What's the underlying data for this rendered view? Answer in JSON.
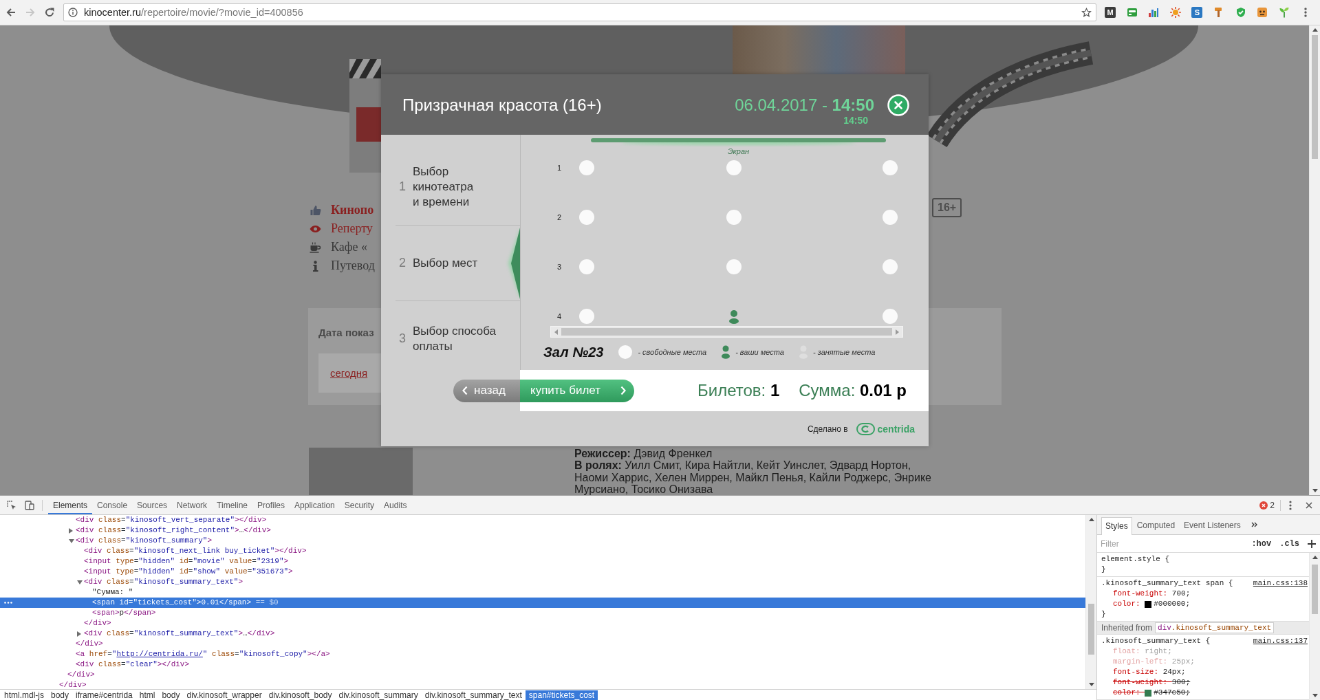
{
  "browser": {
    "nav": [
      {
        "kind": "back",
        "disabled": false
      },
      {
        "kind": "forward",
        "disabled": true
      },
      {
        "kind": "reload",
        "disabled": false
      }
    ],
    "url": {
      "host": "kinocenter.ru",
      "path": "/repertoire/movie/?movie_id=400856"
    },
    "extensions": [
      {
        "kind": "letter",
        "label": "M",
        "color": "#3c3c3c"
      },
      {
        "kind": "window"
      },
      {
        "kind": "bars"
      },
      {
        "kind": "sun"
      },
      {
        "kind": "letter",
        "label": "S",
        "color": "#2b78c2"
      },
      {
        "kind": "hammer"
      },
      {
        "kind": "shield"
      },
      {
        "kind": "mascot"
      },
      {
        "kind": "sprout"
      }
    ]
  },
  "site": {
    "menu": [
      {
        "kind": "like",
        "text": "Кинопо"
      },
      {
        "kind": "eye",
        "text": "Реперту"
      },
      {
        "kind": "cup",
        "text": "Кафе «"
      },
      {
        "kind": "info",
        "text": "Путевод"
      }
    ],
    "age_badge": "16+",
    "date_panel": {
      "label": "Дата показ",
      "options": [
        {
          "text": "сегодня"
        }
      ]
    },
    "director": "**Режиссер:** Дэвид Френкел",
    "cast": "**В ролях:** Уилл Смит, Кира Найтли, Кейт Уинслет, Эдвард Нортон, Наоми Харрис, Хелен Миррен, Майкл Пенья, Кайли Роджерс, Энрике Мурсиано, Тосико Онизава"
  },
  "modal": {
    "title": "Призрачная красота (16+)",
    "date": "06.04.2017 - **14:50**",
    "time": "14:50",
    "steps": [
      {
        "number": "1",
        "label": "Выбор кинотеатра\nи времени",
        "selected": false
      },
      {
        "number": "2",
        "label": "Выбор мест",
        "selected": true
      },
      {
        "number": "3",
        "label": "Выбор способа оплаты",
        "selected": false
      }
    ],
    "screen": "Экран",
    "rows": [
      {
        "label": "1",
        "seats": [
          {
            "selected": false
          },
          {
            "selected": false
          },
          {
            "selected": false
          }
        ]
      },
      {
        "label": "2",
        "seats": [
          {
            "selected": false
          },
          {
            "selected": false
          },
          {
            "selected": false
          }
        ]
      },
      {
        "label": "3",
        "seats": [
          {
            "selected": false
          },
          {
            "selected": false
          },
          {
            "selected": false
          }
        ]
      },
      {
        "label": "4",
        "seats": [
          {
            "selected": false
          },
          {
            "selected": true
          },
          {
            "selected": false
          }
        ]
      }
    ],
    "hall": "Зал №23",
    "legend": [
      {
        "kind": "free",
        "text": "- свободные места"
      },
      {
        "kind": "mine",
        "text": "- ваши места"
      },
      {
        "kind": "taken",
        "text": "- занятые места"
      }
    ],
    "back_button": "назад",
    "buy_button": "купить билет",
    "summary": [
      "Билетов: **1**",
      "Сумма: **0.01 р**"
    ],
    "footer": {
      "credit": "Сделано в",
      "brand": "centrida"
    }
  },
  "devtools": {
    "tabs": [
      {
        "label": "Elements",
        "selected": true
      },
      {
        "label": "Console",
        "selected": false
      },
      {
        "label": "Sources",
        "selected": false
      },
      {
        "label": "Network",
        "selected": false
      },
      {
        "label": "Timeline",
        "selected": false
      },
      {
        "label": "Profiles",
        "selected": false
      },
      {
        "label": "Application",
        "selected": false
      },
      {
        "label": "Security",
        "selected": false
      },
      {
        "label": "Audits",
        "selected": false
      }
    ],
    "error_count": "2",
    "dom_tree": [
      {
        "selected": false,
        "close": "</div>",
        "children": [
          {
            "selected": false,
            "close": "</div>",
            "children": [
              {
                "selected": false,
                "parts": [
                  {
                    "kind": "tag",
                    "text": "<div "
                  },
                  {
                    "kind": "attr",
                    "text": "class"
                  },
                  {
                    "kind": "punct",
                    "text": "="
                  },
                  {
                    "kind": "value",
                    "text": "\"kinosoft_vert_separate\""
                  },
                  {
                    "kind": "tag",
                    "text": "></div>"
                  }
                ]
              },
              {
                "selected": false,
                "expanded": false,
                "parts": [
                  {
                    "kind": "tag",
                    "text": "<div "
                  },
                  {
                    "kind": "attr",
                    "text": "class"
                  },
                  {
                    "kind": "punct",
                    "text": "="
                  },
                  {
                    "kind": "value",
                    "text": "\"kinosoft_right_content\""
                  },
                  {
                    "kind": "tag",
                    "text": ">"
                  },
                  {
                    "kind": "text",
                    "text": "…"
                  },
                  {
                    "kind": "tag",
                    "text": "</div>"
                  }
                ]
              },
              {
                "selected": false,
                "expanded": true,
                "parts": [
                  {
                    "kind": "tag",
                    "text": "<div "
                  },
                  {
                    "kind": "attr",
                    "text": "class"
                  },
                  {
                    "kind": "punct",
                    "text": "="
                  },
                  {
                    "kind": "value",
                    "text": "\"kinosoft_summary\""
                  },
                  {
                    "kind": "tag",
                    "text": ">"
                  }
                ],
                "close": "</div>",
                "children": [
                  {
                    "selected": false,
                    "parts": [
                      {
                        "kind": "tag",
                        "text": "<div "
                      },
                      {
                        "kind": "attr",
                        "text": "class"
                      },
                      {
                        "kind": "punct",
                        "text": "="
                      },
                      {
                        "kind": "value",
                        "text": "\"kinosoft_next_link buy_ticket\""
                      },
                      {
                        "kind": "tag",
                        "text": "></div>"
                      }
                    ]
                  },
                  {
                    "selected": false,
                    "parts": [
                      {
                        "kind": "tag",
                        "text": "<input "
                      },
                      {
                        "kind": "attr",
                        "text": "type"
                      },
                      {
                        "kind": "punct",
                        "text": "="
                      },
                      {
                        "kind": "value",
                        "text": "\"hidden\""
                      },
                      {
                        "kind": "attr",
                        "text": " id"
                      },
                      {
                        "kind": "punct",
                        "text": "="
                      },
                      {
                        "kind": "value",
                        "text": "\"movie\""
                      },
                      {
                        "kind": "attr",
                        "text": " value"
                      },
                      {
                        "kind": "punct",
                        "text": "="
                      },
                      {
                        "kind": "value",
                        "text": "\"2319\""
                      },
                      {
                        "kind": "tag",
                        "text": ">"
                      }
                    ]
                  },
                  {
                    "selected": false,
                    "parts": [
                      {
                        "kind": "tag",
                        "text": "<input "
                      },
                      {
                        "kind": "attr",
                        "text": "type"
                      },
                      {
                        "kind": "punct",
                        "text": "="
                      },
                      {
                        "kind": "value",
                        "text": "\"hidden\""
                      },
                      {
                        "kind": "attr",
                        "text": " id"
                      },
                      {
                        "kind": "punct",
                        "text": "="
                      },
                      {
                        "kind": "value",
                        "text": "\"show\""
                      },
                      {
                        "kind": "attr",
                        "text": " value"
                      },
                      {
                        "kind": "punct",
                        "text": "="
                      },
                      {
                        "kind": "value",
                        "text": "\"351673\""
                      },
                      {
                        "kind": "tag",
                        "text": ">"
                      }
                    ]
                  },
                  {
                    "selected": false,
                    "expanded": true,
                    "parts": [
                      {
                        "kind": "tag",
                        "text": "<div "
                      },
                      {
                        "kind": "attr",
                        "text": "class"
                      },
                      {
                        "kind": "punct",
                        "text": "="
                      },
                      {
                        "kind": "value",
                        "text": "\"kinosoft_summary_text\""
                      },
                      {
                        "kind": "tag",
                        "text": ">"
                      }
                    ],
                    "close": "</div>",
                    "children": [
                      {
                        "selected": false,
                        "parts": [
                          {
                            "kind": "text",
                            "text": "\"Сумма: \""
                          }
                        ]
                      },
                      {
                        "selected": true,
                        "parts": [
                          {
                            "kind": "tag",
                            "text": "<span "
                          },
                          {
                            "kind": "attr",
                            "text": "id"
                          },
                          {
                            "kind": "punct",
                            "text": "="
                          },
                          {
                            "kind": "value",
                            "text": "\"tickets_cost\""
                          },
                          {
                            "kind": "tag",
                            "text": ">"
                          },
                          {
                            "kind": "text",
                            "text": "0.01"
                          },
                          {
                            "kind": "tag",
                            "text": "</span>"
                          },
                          {
                            "kind": "note",
                            "text": " == $0"
                          }
                        ]
                      },
                      {
                        "selected": false,
                        "parts": [
                          {
                            "kind": "tag",
                            "text": "<span>"
                          },
                          {
                            "kind": "text",
                            "text": "р"
                          },
                          {
                            "kind": "tag",
                            "text": "</span>"
                          }
                        ]
                      }
                    ]
                  },
                  {
                    "selected": false,
                    "expanded": false,
                    "parts": [
                      {
                        "kind": "tag",
                        "text": "<div "
                      },
                      {
                        "kind": "attr",
                        "text": "class"
                      },
                      {
                        "kind": "punct",
                        "text": "="
                      },
                      {
                        "kind": "value",
                        "text": "\"kinosoft_summary_text\""
                      },
                      {
                        "kind": "tag",
                        "text": ">"
                      },
                      {
                        "kind": "text",
                        "text": "…"
                      },
                      {
                        "kind": "tag",
                        "text": "</div>"
                      }
                    ]
                  }
                ]
              },
              {
                "selected": false,
                "parts": [
                  {
                    "kind": "tag",
                    "text": "<a "
                  },
                  {
                    "kind": "attr",
                    "text": "href"
                  },
                  {
                    "kind": "punct",
                    "text": "="
                  },
                  {
                    "kind": "value",
                    "text": "\""
                  },
                  {
                    "kind": "link",
                    "text": "http://centrida.ru/"
                  },
                  {
                    "kind": "value",
                    "text": "\""
                  },
                  {
                    "kind": "attr",
                    "text": " class"
                  },
                  {
                    "kind": "punct",
                    "text": "="
                  },
                  {
                    "kind": "value",
                    "text": "\"kinosoft_copy\""
                  },
                  {
                    "kind": "tag",
                    "text": "></a>"
                  }
                ]
              },
              {
                "selected": false,
                "parts": [
                  {
                    "kind": "tag",
                    "text": "<div "
                  },
                  {
                    "kind": "attr",
                    "text": "class"
                  },
                  {
                    "kind": "punct",
                    "text": "="
                  },
                  {
                    "kind": "value",
                    "text": "\"clear\""
                  },
                  {
                    "kind": "tag",
                    "text": "></div>"
                  }
                ]
              }
            ]
          }
        ]
      }
    ],
    "breadcrumbs": [
      {
        "label": "html.mdl-js",
        "selected": false
      },
      {
        "label": "body",
        "selected": false
      },
      {
        "label": "iframe#centrida",
        "selected": false
      },
      {
        "label": "html",
        "selected": false
      },
      {
        "label": "body",
        "selected": false
      },
      {
        "label": "div.kinosoft_wrapper",
        "selected": false
      },
      {
        "label": "div.kinosoft_body",
        "selected": false
      },
      {
        "label": "div.kinosoft_summary",
        "selected": false
      },
      {
        "label": "div.kinosoft_summary_text",
        "selected": false
      },
      {
        "label": "span#tickets_cost",
        "selected": true
      }
    ],
    "style_tabs": [
      {
        "label": "Styles",
        "selected": true
      },
      {
        "label": "Computed",
        "selected": false
      },
      {
        "label": "Event Listeners",
        "selected": false
      }
    ],
    "filter": {
      "placeholder": "Filter"
    },
    "filter_buttons": [
      ":hov",
      ".cls"
    ],
    "style_sections": [
      {
        "kind": "rule",
        "selector": "element.style {",
        "close": "}"
      },
      {
        "kind": "rule",
        "selector": ".kinosoft_summary_text span {",
        "source": "main.css:138",
        "properties": [
          {
            "name": "font-weight: ",
            "value": "700;",
            "inactive": false,
            "overridden": false
          },
          {
            "name": "color: ",
            "value": "#000000;",
            "color": "#000000",
            "inactive": false,
            "overridden": false
          }
        ],
        "close": "}"
      },
      {
        "kind": "inherited",
        "label": "Inherited from",
        "tag": "div",
        "selector": ".kinosoft_summary_text"
      },
      {
        "kind": "rule",
        "selector": ".kinosoft_summary_text {",
        "source": "main.css:137",
        "properties": [
          {
            "name": "float: ",
            "value": "right;",
            "inactive": true,
            "overridden": false
          },
          {
            "name": "margin-left: ",
            "value": "25px;",
            "inactive": true,
            "overridden": false
          },
          {
            "name": "font-size: ",
            "value": "24px;",
            "inactive": false,
            "overridden": false
          },
          {
            "name": "font-weight: ",
            "value": "300;",
            "inactive": false,
            "overridden": true
          },
          {
            "name": "color: ",
            "value": "#347c50;",
            "color": "#347c50",
            "inactive": false,
            "overridden": true
          }
        ]
      }
    ]
  }
}
